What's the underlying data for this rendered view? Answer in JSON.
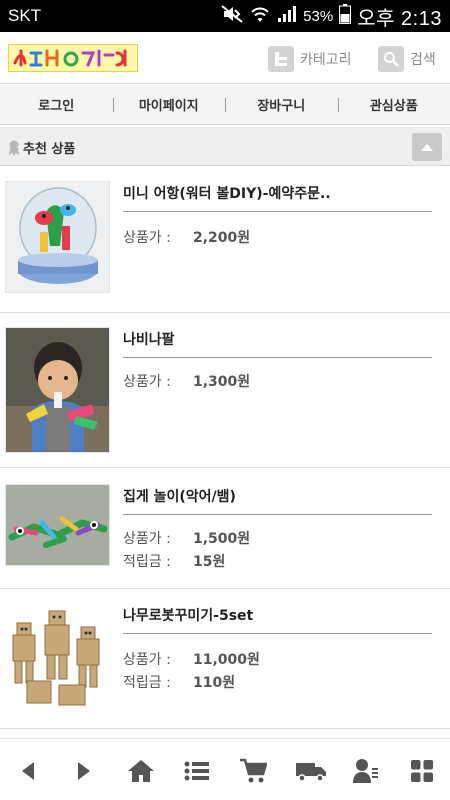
{
  "status_bar": {
    "carrier": "SKT",
    "battery_percent": "53%",
    "time": "오후 2:13"
  },
  "header": {
    "logo_text": "신나는미술",
    "category_label": "카테고리",
    "search_label": "검색"
  },
  "nav": {
    "items": [
      {
        "label": "로그인"
      },
      {
        "label": "마이페이지"
      },
      {
        "label": "장바구니"
      },
      {
        "label": "관심상품"
      }
    ]
  },
  "section": {
    "title": "추천 상품"
  },
  "products": [
    {
      "name": "미니 어항(워터 볼DIY)-예약주문..",
      "price_label": "상품가 :",
      "price": "2,200원"
    },
    {
      "name": "나비나팔",
      "price_label": "상품가 :",
      "price": "1,300원"
    },
    {
      "name": "집게 놀이(악어/뱀)",
      "price_label": "상품가 :",
      "price": "1,500원",
      "points_label": "적립금 :",
      "points": "15원"
    },
    {
      "name": "나무로봇꾸미기-5set",
      "price_label": "상품가 :",
      "price": "11,000원",
      "points_label": "적립금 :",
      "points": "110원"
    }
  ],
  "bottom_bar": {
    "icons": [
      "back-arrow-icon",
      "forward-arrow-icon",
      "home-icon",
      "list-icon",
      "cart-icon",
      "delivery-truck-icon",
      "my-account-icon",
      "grid-menu-icon"
    ]
  },
  "colors": {
    "icon_gray": "#555555",
    "nav_bg": "#f4f4f4",
    "status_bg": "#000000"
  }
}
